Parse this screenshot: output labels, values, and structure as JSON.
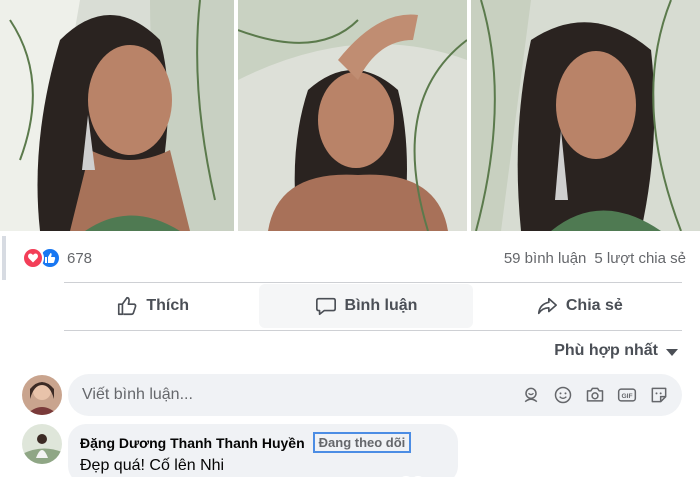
{
  "post": {
    "photos": [
      {
        "name": "photo-1",
        "alt_icon": "photo"
      },
      {
        "name": "photo-2",
        "alt_icon": "photo"
      },
      {
        "name": "photo-3",
        "alt_icon": "photo"
      }
    ],
    "reactions": {
      "icons": [
        "heart-icon",
        "like-icon"
      ],
      "count": "678",
      "comments": "59 bình luận",
      "shares": "5 lượt chia sẻ"
    },
    "actions": {
      "like": "Thích",
      "comment": "Bình luận",
      "share": "Chia sẻ"
    }
  },
  "comments": {
    "sort_label": "Phù hợp nhất",
    "composer": {
      "placeholder": "Viết bình luận...",
      "tools": [
        "avatar-sticker-icon",
        "emoji-icon",
        "camera-icon",
        "gif-icon",
        "sticker-icon"
      ]
    },
    "items": [
      {
        "author": "Đặng Dương Thanh Thanh Huyền",
        "badge": "Đang theo dõi",
        "text": "Đẹp quá! Cố lên Nhi"
      }
    ]
  },
  "colors": {
    "accent": "#1877f2",
    "heart": "#f33e58",
    "text_secondary": "#65676b",
    "bubble_bg": "#f0f2f5"
  }
}
